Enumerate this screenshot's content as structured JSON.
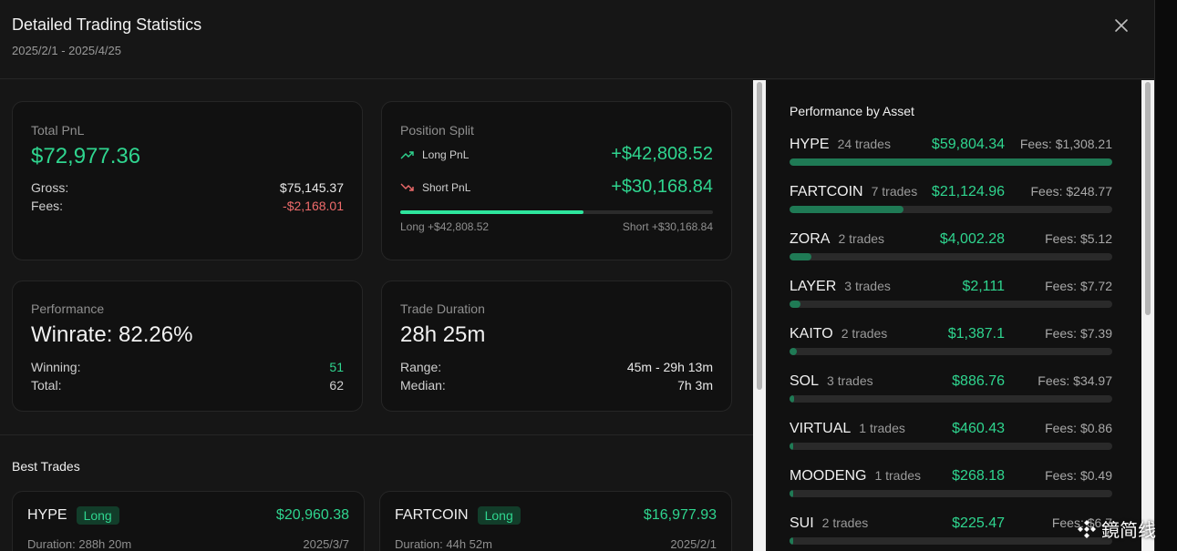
{
  "header": {
    "title": "Detailed Trading Statistics",
    "date_range": "2025/2/1 - 2025/4/25"
  },
  "total_pnl": {
    "label": "Total PnL",
    "value": "$72,977.36",
    "gross_label": "Gross:",
    "gross_value": "$75,145.37",
    "fees_label": "Fees:",
    "fees_value": "-$2,168.01"
  },
  "position_split": {
    "label": "Position Split",
    "long_label": "Long PnL",
    "long_value": "+$42,808.52",
    "short_label": "Short PnL",
    "short_value": "+$30,168.84",
    "long_fraction": 0.587,
    "long_caption": "Long +$42,808.52",
    "short_caption": "Short +$30,168.84"
  },
  "performance": {
    "label": "Performance",
    "value": "Winrate: 82.26%",
    "winning_label": "Winning:",
    "winning_value": "51",
    "total_label": "Total:",
    "total_value": "62"
  },
  "trade_duration": {
    "label": "Trade Duration",
    "value": "28h 25m",
    "range_label": "Range:",
    "range_value": "45m - 29h 13m",
    "median_label": "Median:",
    "median_value": "7h 3m"
  },
  "best_trades": {
    "title": "Best Trades",
    "items": [
      {
        "asset": "HYPE",
        "side": "Long",
        "pnl": "$20,960.38",
        "duration": "Duration: 288h 20m",
        "date": "2025/3/7"
      },
      {
        "asset": "FARTCOIN",
        "side": "Long",
        "pnl": "$16,977.93",
        "duration": "Duration: 44h 52m",
        "date": "2025/2/1"
      }
    ]
  },
  "asset_performance": {
    "title": "Performance by Asset",
    "items": [
      {
        "name": "HYPE",
        "trades": "24 trades",
        "pnl": "$59,804.34",
        "fees": "Fees: $1,308.21",
        "share": 1.0
      },
      {
        "name": "FARTCOIN",
        "trades": "7 trades",
        "pnl": "$21,124.96",
        "fees": "Fees: $248.77",
        "share": 0.353
      },
      {
        "name": "ZORA",
        "trades": "2 trades",
        "pnl": "$4,002.28",
        "fees": "Fees: $5.12",
        "share": 0.067
      },
      {
        "name": "LAYER",
        "trades": "3 trades",
        "pnl": "$2,111",
        "fees": "Fees: $7.72",
        "share": 0.035
      },
      {
        "name": "KAITO",
        "trades": "2 trades",
        "pnl": "$1,387.1",
        "fees": "Fees: $7.39",
        "share": 0.023
      },
      {
        "name": "SOL",
        "trades": "3 trades",
        "pnl": "$886.76",
        "fees": "Fees: $34.97",
        "share": 0.015
      },
      {
        "name": "VIRTUAL",
        "trades": "1 trades",
        "pnl": "$460.43",
        "fees": "Fees: $0.86",
        "share": 0.008
      },
      {
        "name": "MOODENG",
        "trades": "1 trades",
        "pnl": "$268.18",
        "fees": "Fees: $0.49",
        "share": 0.004
      },
      {
        "name": "SUI",
        "trades": "2 trades",
        "pnl": "$225.47",
        "fees": "Fees: $6.7",
        "share": 0.004
      }
    ]
  },
  "watermark": "鏡简线",
  "colors": {
    "positive": "#2fd58f",
    "negative": "#ef6b6b",
    "background": "#161616",
    "card": "#111111"
  }
}
